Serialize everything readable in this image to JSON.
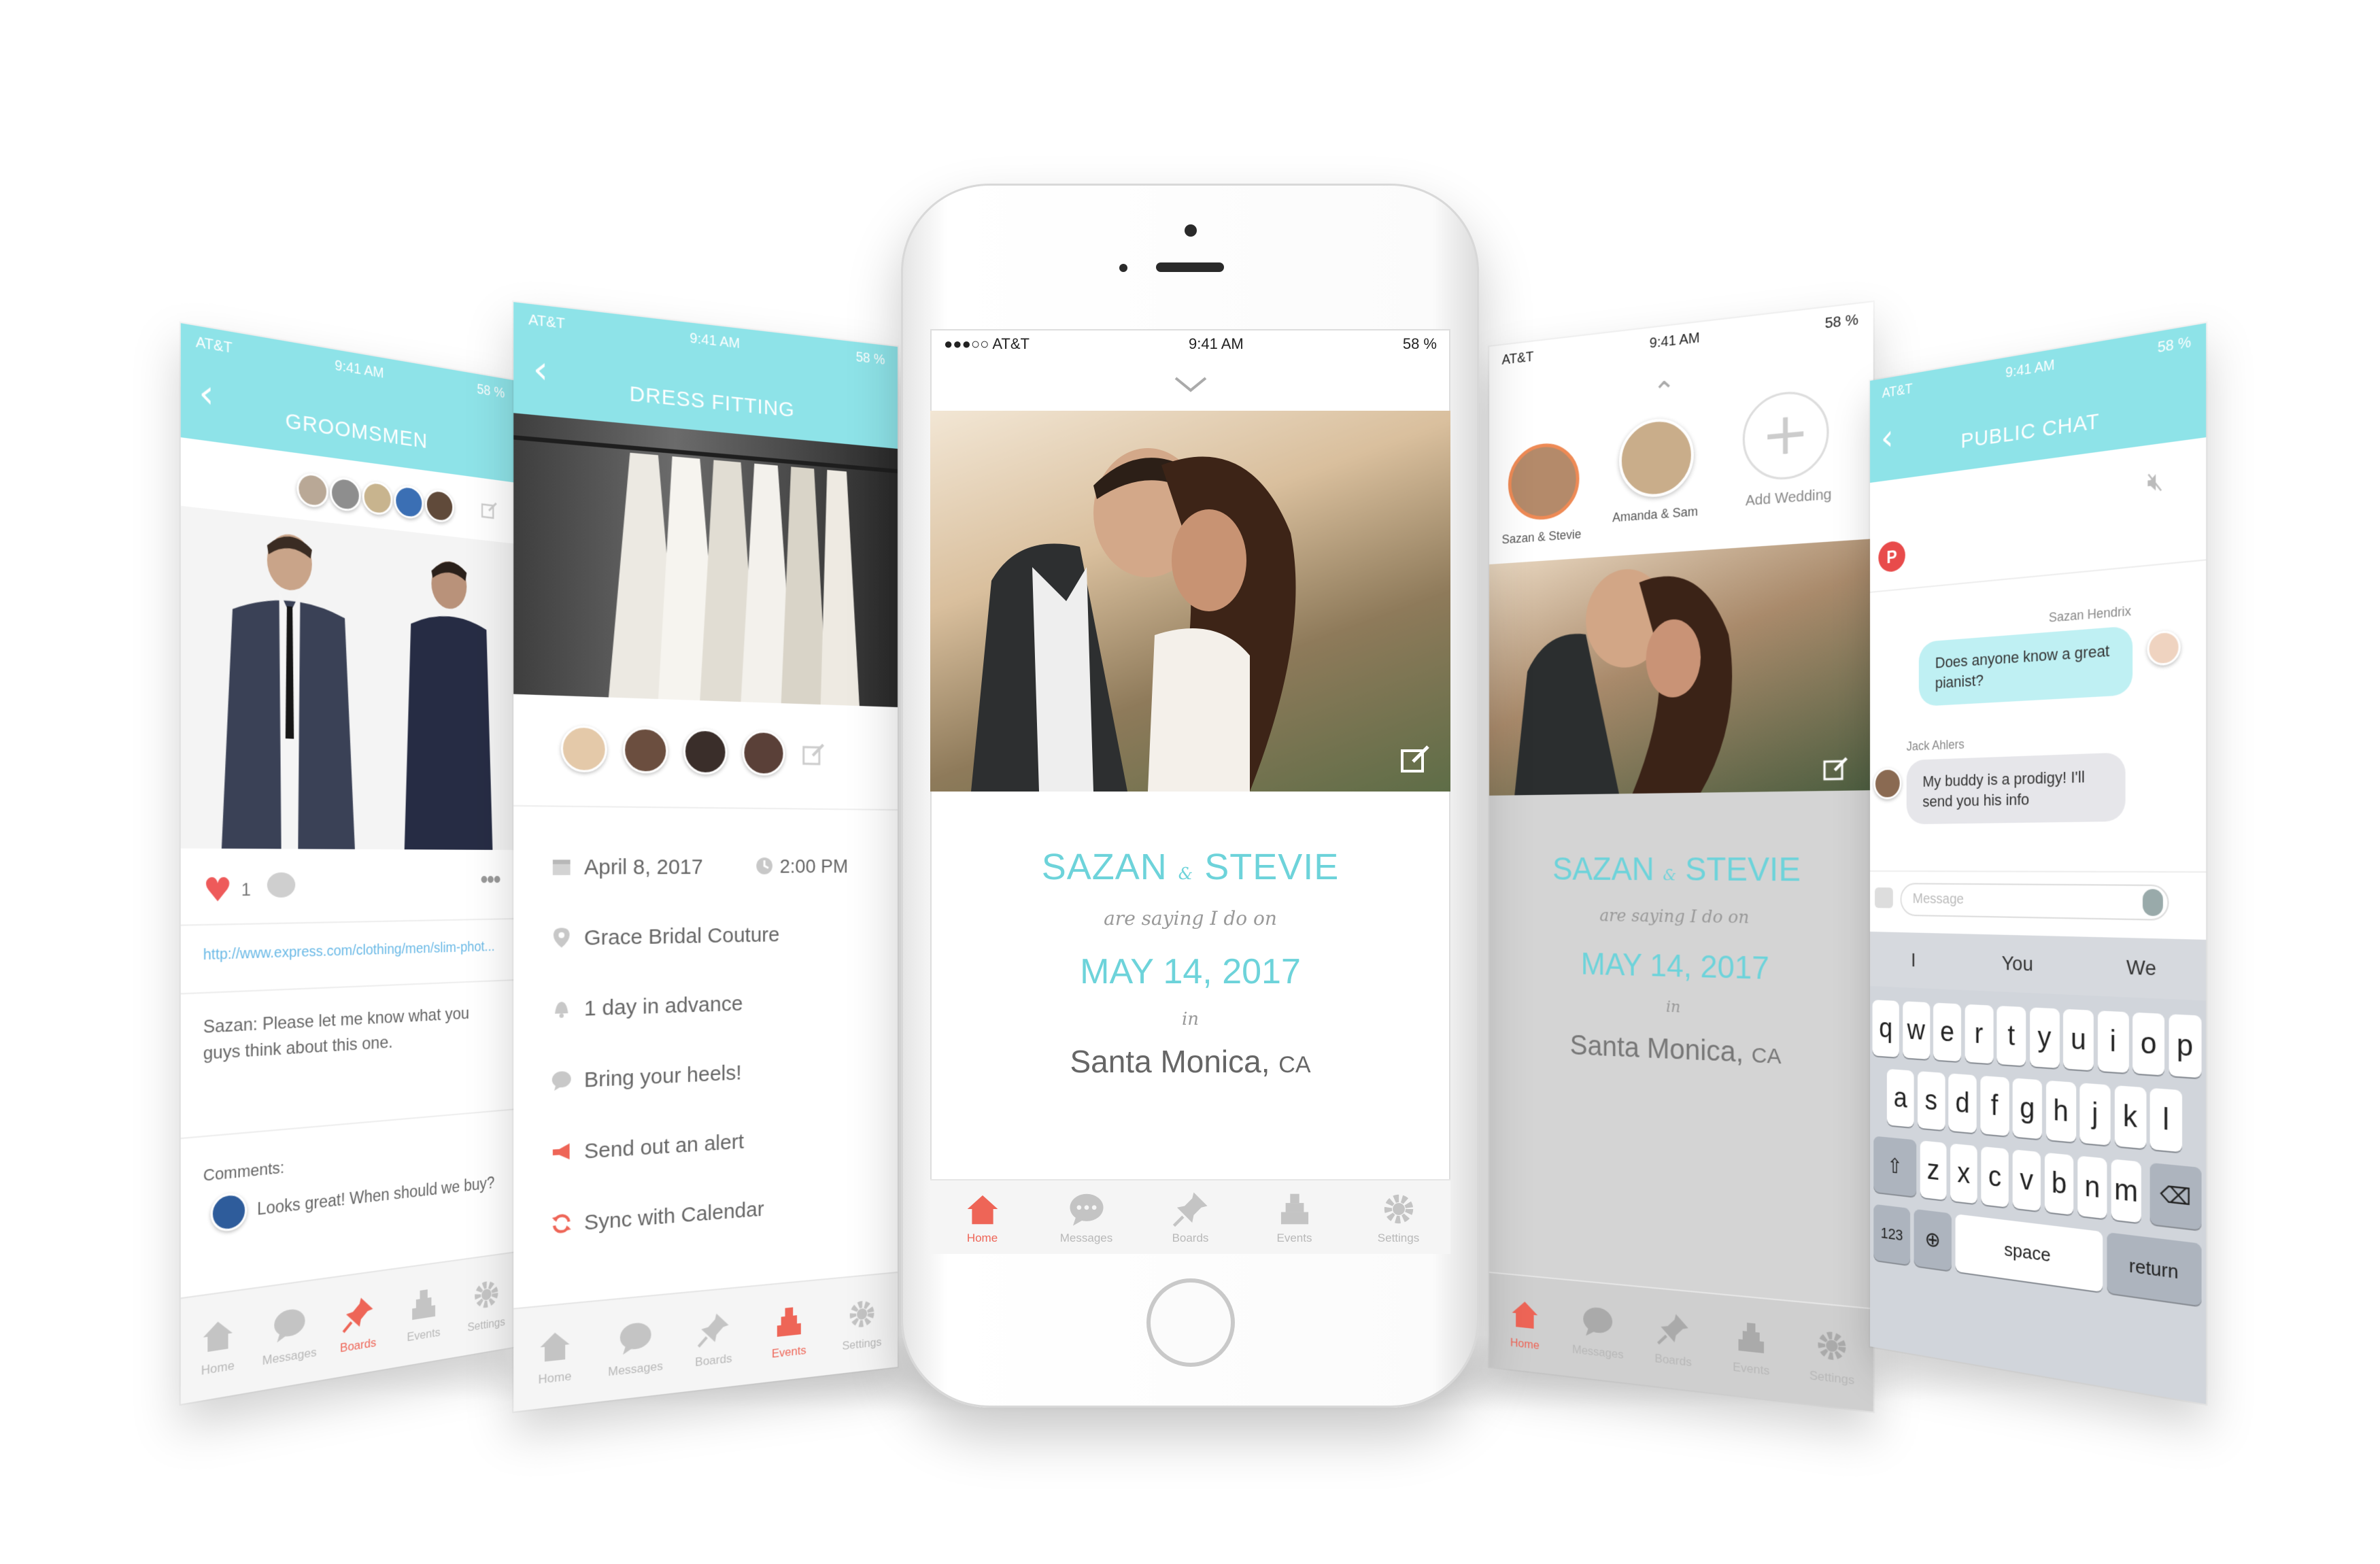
{
  "status": {
    "carrier": "AT&T",
    "time": "9:41 AM",
    "battery": "58 %"
  },
  "colors": {
    "teal": "#8ee3e8",
    "accent": "#ee6557",
    "names": "#6dd3da",
    "chat_user": "#bff0f3"
  },
  "tabs": [
    "Home",
    "Messages",
    "Boards",
    "Events",
    "Settings"
  ],
  "groomsmen": {
    "title": "GROOMSMEN",
    "like_count": "1",
    "link": "http://www.express.com/clothing/men/slim-phot...",
    "note": "Sazan: Please let me know what you guys think about this one.",
    "comments_label": "Comments:",
    "comment": "Looks great! When should we buy?"
  },
  "dress": {
    "title": "DRESS FITTING",
    "date": "April 8, 2017",
    "time": "2:00 PM",
    "location": "Grace Bridal Couture",
    "reminder": "1 day in advance",
    "note": "Bring your heels!",
    "alert": "Send out an alert",
    "sync": "Sync with Calendar"
  },
  "home": {
    "name1": "SAZAN",
    "amp": "&",
    "name2": "STEVIE",
    "saying": "are saying I do on",
    "date": "MAY 14, 2017",
    "in": "in",
    "city": "Santa Monica",
    "state": "CA"
  },
  "weddings": {
    "items": [
      "Sazan & Stevie",
      "Amanda & Sam",
      "Add Wedding"
    ]
  },
  "chat": {
    "title": "PUBLIC CHAT",
    "sender1": "Sazan Hendrix",
    "message1": "Does anyone know a great pianist?",
    "sender2": "Jack Ahlers",
    "message2": "My buddy is a prodigy! I'll send you his info",
    "placeholder": "Message",
    "suggestions": [
      "I",
      "You",
      "We"
    ],
    "row1": [
      "q",
      "w",
      "e",
      "r",
      "t",
      "y",
      "u",
      "i",
      "o",
      "p"
    ],
    "row2": [
      "a",
      "s",
      "d",
      "f",
      "g",
      "h",
      "j",
      "k",
      "l"
    ],
    "row3": [
      "z",
      "x",
      "c",
      "v",
      "b",
      "n",
      "m"
    ],
    "num_key": "123",
    "space": "space",
    "return": "return"
  }
}
